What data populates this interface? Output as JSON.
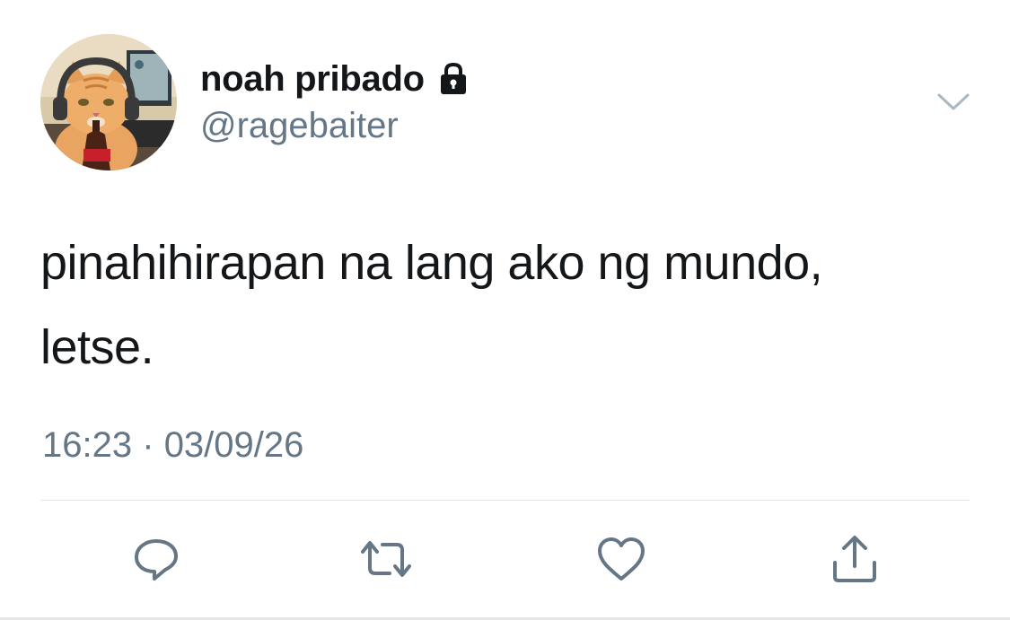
{
  "tweet": {
    "author": {
      "display_name": "noah pribado",
      "handle": "@ragebaiter",
      "protected_icon": "lock-icon",
      "avatar_icon": "cat-avatar"
    },
    "text_lines": [
      "pinahihirapan na lang ako ng mundo,",
      "letse."
    ],
    "time": "16:23",
    "separator": "·",
    "date": "03/09/26"
  },
  "actions": [
    {
      "icon": "reply-icon"
    },
    {
      "icon": "retweet-icon"
    },
    {
      "icon": "like-icon"
    },
    {
      "icon": "share-icon"
    }
  ],
  "menu": {
    "icon": "chevron-down-icon"
  },
  "colors": {
    "text_primary": "#14171a",
    "text_secondary": "#657786",
    "icon_gray": "#657786",
    "divider": "#e1e8ed"
  }
}
